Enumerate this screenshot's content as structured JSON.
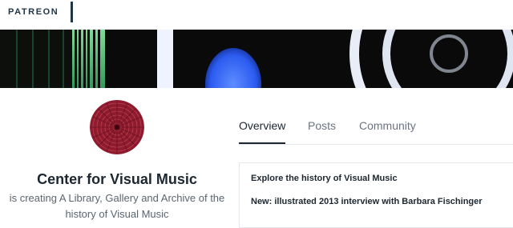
{
  "header": {
    "logo_text": "PATREON"
  },
  "banner": {
    "description_icon": "visual-music-banner-image"
  },
  "creator": {
    "name": "Center for Visual Music",
    "description": "is creating A Library, Gallery and Archive of the history of Visual Music",
    "avatar_color": "#8e1b2e"
  },
  "tabs": [
    {
      "label": "Overview",
      "active": true
    },
    {
      "label": "Posts",
      "active": false
    },
    {
      "label": "Community",
      "active": false
    }
  ],
  "post": {
    "title": "Explore the history of Visual Music",
    "subtitle": "New: illustrated 2013 interview with Barbara Fischinger"
  },
  "colors": {
    "brand_navy": "#1f3548",
    "text_dark": "#1d2731",
    "text_muted": "#5b6570"
  }
}
